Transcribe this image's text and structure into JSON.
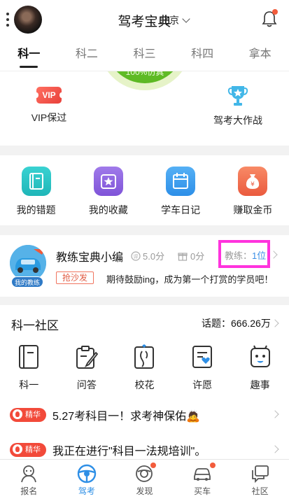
{
  "header": {
    "title": "驾考宝典",
    "city": "北京"
  },
  "tabs": [
    {
      "label": "科一",
      "active": true
    },
    {
      "label": "科二",
      "active": false
    },
    {
      "label": "科三",
      "active": false
    },
    {
      "label": "科四",
      "active": false
    },
    {
      "label": "拿本",
      "active": false
    }
  ],
  "exam_circle": {
    "label": "100%仿真"
  },
  "vip": {
    "left_label": "VIP保过",
    "left_badge": "VIP",
    "right_label": "驾考大作战"
  },
  "tools": [
    {
      "label": "我的错题",
      "icon": "notebook-icon",
      "color": "#28c6c6"
    },
    {
      "label": "我的收藏",
      "icon": "favorites-star-icon",
      "color": "#8d62e0"
    },
    {
      "label": "学车日记",
      "icon": "calendar-icon",
      "color": "#3d9ef2"
    },
    {
      "label": "赚取金币",
      "icon": "coin-bag-icon",
      "color": "#f06a4d"
    }
  ],
  "coach": {
    "name": "教练宝典小编",
    "score": "5.0分",
    "gifts": "0分",
    "count_label": "教练：",
    "count_value": "1位",
    "tag": "我的教练",
    "grab_label": "抢沙发",
    "message": "期待鼓励ing，成为第一个打赏的学员吧！"
  },
  "community": {
    "title": "科一社区",
    "topics": "话题：666.26万",
    "icons": [
      {
        "label": "科一",
        "icon": "book-icon"
      },
      {
        "label": "问答",
        "icon": "qa-pen-icon"
      },
      {
        "label": "校花",
        "icon": "school-flower-icon"
      },
      {
        "label": "许愿",
        "icon": "wish-heart-icon"
      },
      {
        "label": "趣事",
        "icon": "fun-face-icon"
      }
    ],
    "posts": [
      {
        "badge": "精华",
        "text": "5.27考科目一！求考神保佑🙇"
      },
      {
        "badge": "精华",
        "text": "我正在进行\"科目一法规培训\"。"
      }
    ]
  },
  "bottom_nav": [
    {
      "label": "报名",
      "icon": "signup-icon",
      "active": false,
      "dot": false
    },
    {
      "label": "驾考",
      "icon": "steering-wheel-icon",
      "active": true,
      "dot": false
    },
    {
      "label": "发现",
      "icon": "discover-icon",
      "active": false,
      "dot": true
    },
    {
      "label": "买车",
      "icon": "car-icon",
      "active": false,
      "dot": true
    },
    {
      "label": "社区",
      "icon": "community-chat-icon",
      "active": false,
      "dot": false
    }
  ],
  "colors": {
    "accent": "#2e8fe6",
    "highlight_box": "#ff33dd",
    "badge_red": "#f24a3a"
  }
}
